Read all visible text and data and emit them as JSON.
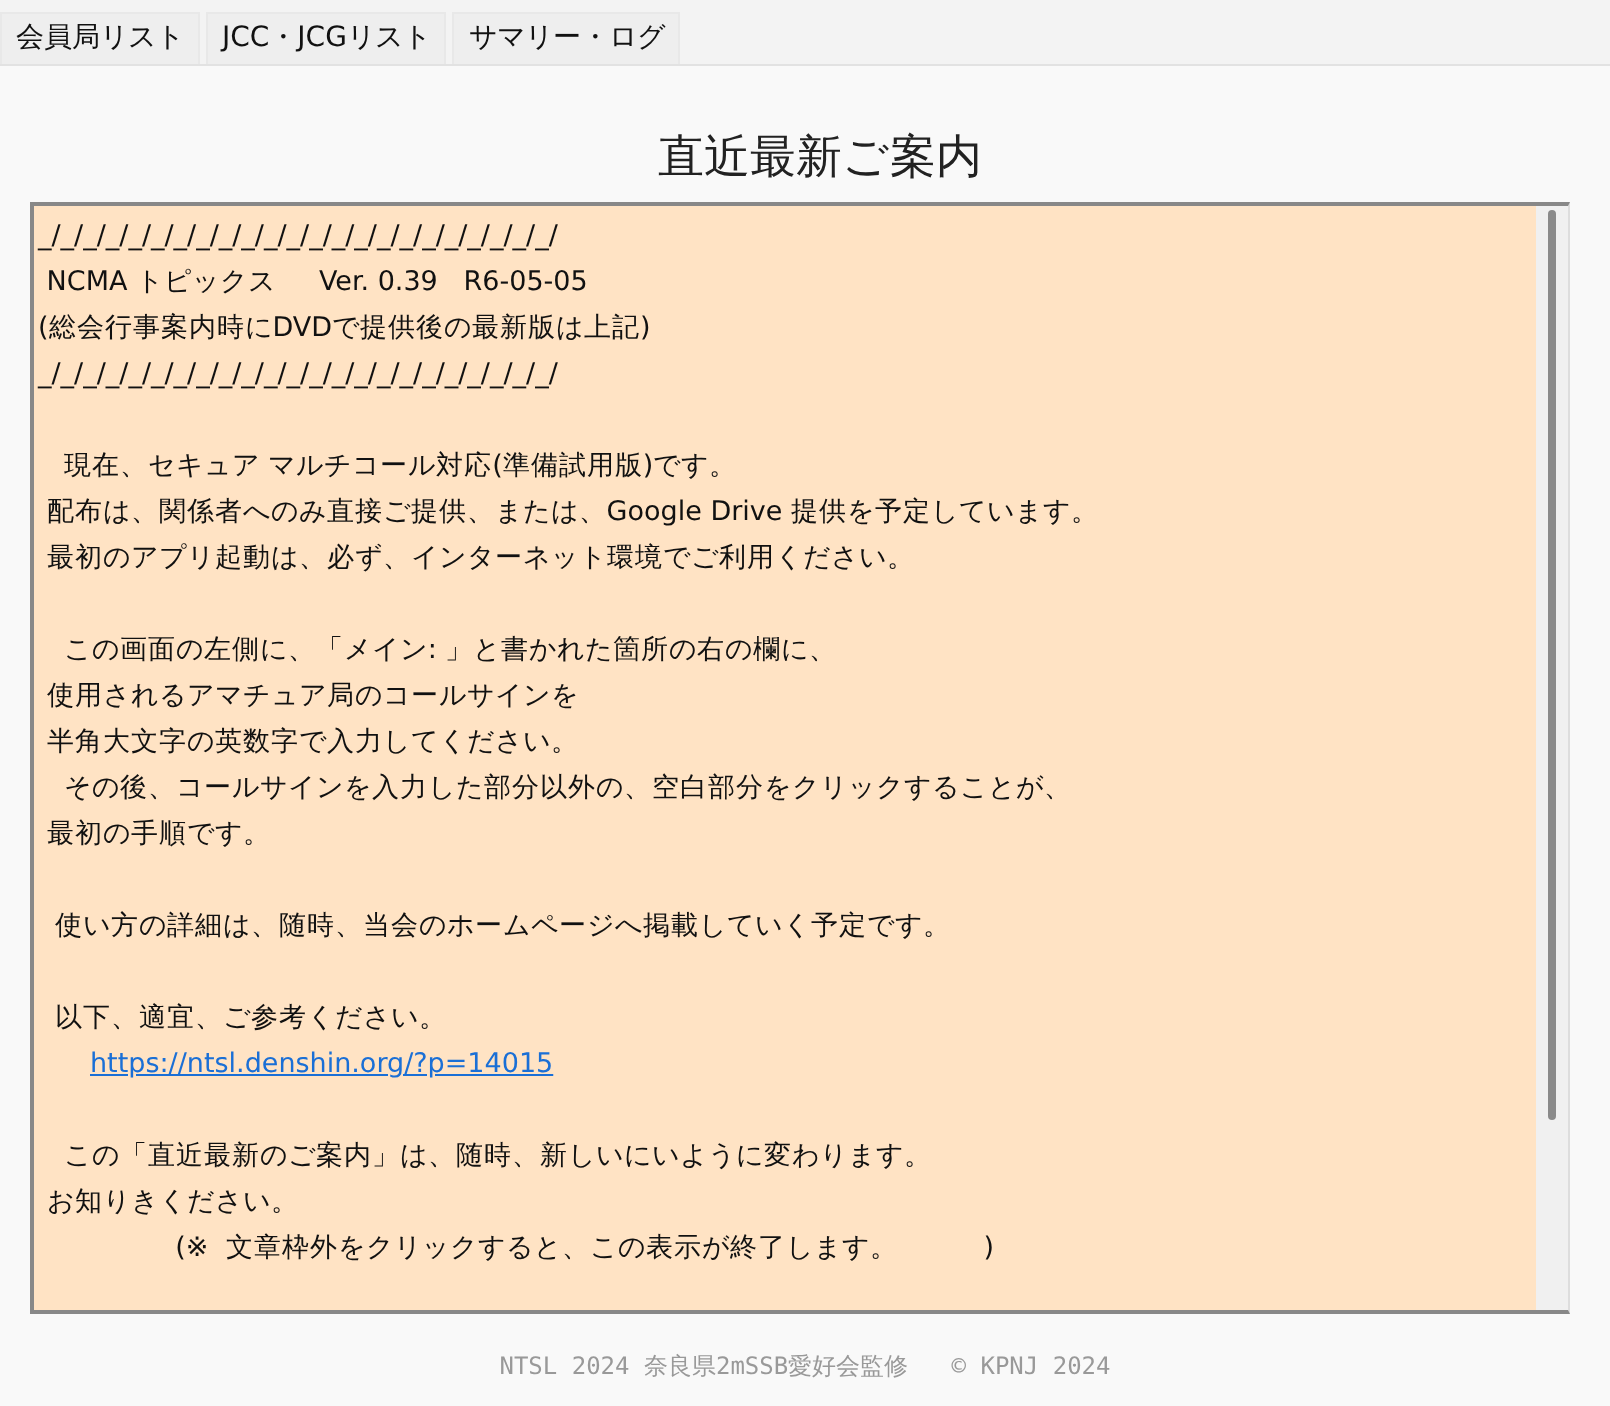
{
  "tabs": [
    {
      "label": "会員局リスト",
      "selected": false
    },
    {
      "label": "JCC・JCGリスト",
      "selected": false
    },
    {
      "label": "サマリー・ログ",
      "selected": false
    }
  ],
  "heading": "直近最新ご案内",
  "notice": {
    "paragraphs": [
      [
        {
          "kind": "text",
          "text": "_/_/_/_/_/_/_/_/_/_/_/_/_/_/_/_/_/_/_/_/_/_/_/"
        },
        {
          "kind": "text",
          "text": " NCMA トピックス     Ver. 0.39   R6-05-05"
        },
        {
          "kind": "text",
          "text": "(総会行事案内時にDVDで提供後の最新版は上記)"
        },
        {
          "kind": "text",
          "text": "_/_/_/_/_/_/_/_/_/_/_/_/_/_/_/_/_/_/_/_/_/_/_/"
        }
      ],
      [
        {
          "kind": "text",
          "text": "   現在、セキュア マルチコール対応(準備試用版)です。"
        },
        {
          "kind": "text",
          "text": " 配布は、関係者へのみ直接ご提供、または、Google Drive 提供を予定しています。"
        },
        {
          "kind": "text",
          "text": " 最初のアプリ起動は、必ず、インターネット環境でご利用ください。"
        }
      ],
      [
        {
          "kind": "text",
          "text": "   この画面の左側に、「メイン: 」と書かれた箇所の右の欄に、"
        },
        {
          "kind": "text",
          "text": " 使用されるアマチュア局のコールサインを"
        },
        {
          "kind": "text",
          "text": " 半角大文字の英数字で入力してください。"
        },
        {
          "kind": "text",
          "text": "   その後、コールサインを入力した部分以外の、空白部分をクリックすることが、"
        },
        {
          "kind": "text",
          "text": " 最初の手順です。"
        }
      ],
      [
        {
          "kind": "text",
          "text": "  使い方の詳細は、随時、当会のホームページへ掲載していく予定です。"
        }
      ],
      [
        {
          "kind": "text",
          "text": "  以下、適宜、ご参考ください。"
        },
        {
          "kind": "link",
          "text": "https://ntsl.denshin.org/?p=14015"
        }
      ],
      [
        {
          "kind": "text",
          "text": "   この「直近最新のご案内」は、随時、新しいにいように変わります。"
        },
        {
          "kind": "text",
          "text": " お知りきください。"
        },
        {
          "kind": "text",
          "text": "                (※  文章枠外をクリックすると、この表示が終了します。          )"
        }
      ]
    ]
  },
  "footer": "NTSL 2024 奈良県2mSSB愛好会監修   © KPNJ 2024"
}
